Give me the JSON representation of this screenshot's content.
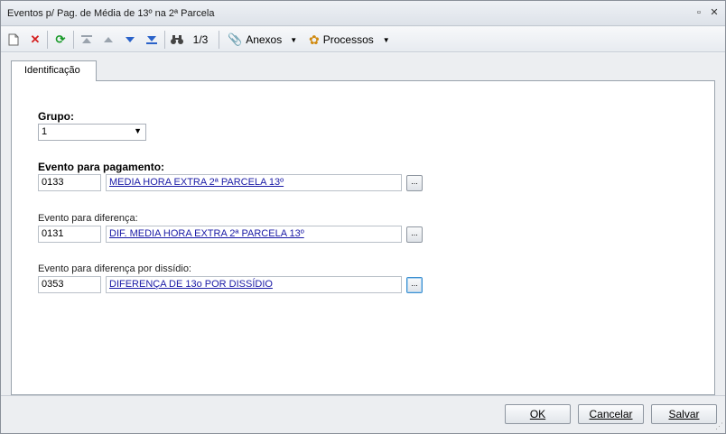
{
  "window": {
    "title": "Eventos p/ Pag. de Média de 13º na 2ª Parcela"
  },
  "toolbar": {
    "record_position": "1/3",
    "anexos_label": "Anexos",
    "processos_label": "Processos"
  },
  "tabs": [
    {
      "label": "Identificação"
    }
  ],
  "form": {
    "grupo": {
      "label": "Grupo:",
      "value": "1"
    },
    "evento_pagamento": {
      "label": "Evento para pagamento:",
      "code": "0133",
      "description": "MEDIA HORA EXTRA 2ª PARCELA 13º"
    },
    "evento_diferenca": {
      "label": "Evento para diferença:",
      "code": "0131",
      "description": "DIF. MEDIA HORA EXTRA 2ª PARCELA 13º"
    },
    "evento_dissidio": {
      "label": "Evento para diferença por dissídio:",
      "code": "0353",
      "description": "DIFERENÇA DE 13o POR DISSÍDIO"
    },
    "lookup_label": "..."
  },
  "footer": {
    "ok_label": "OK",
    "cancel_label": "Cancelar",
    "save_label": "Salvar"
  }
}
